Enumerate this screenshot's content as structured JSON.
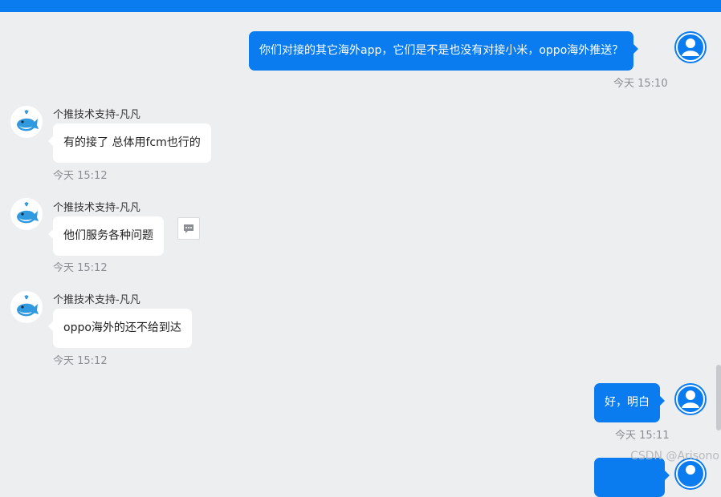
{
  "messages": [
    {
      "side": "out",
      "text": "你们对接的其它海外app，它们是不是也没有对接小米，oppo海外推送？",
      "time": "今天 15:10"
    },
    {
      "side": "in",
      "sender": "个推技术支持-凡凡",
      "text": "有的接了 总体用fcm也行的",
      "time": "今天 15:12"
    },
    {
      "side": "in",
      "sender": "个推技术支持-凡凡",
      "text": "他们服务各种问题",
      "time": "今天 15:12"
    },
    {
      "side": "in",
      "sender": "个推技术支持-凡凡",
      "text": "oppo海外的还不给到达",
      "time": "今天 15:12"
    },
    {
      "side": "out",
      "text": "好，明白",
      "time": "今天 15:11"
    }
  ],
  "watermark": "CSDN @Arisono",
  "colors": {
    "accent": "#0a7cf0",
    "background": "#edeef0",
    "bubble_in": "#ffffff"
  },
  "icons": {
    "user_avatar": "user-avatar-icon",
    "support_avatar": "whale-avatar-icon",
    "quote": "quote-bubble-icon"
  }
}
